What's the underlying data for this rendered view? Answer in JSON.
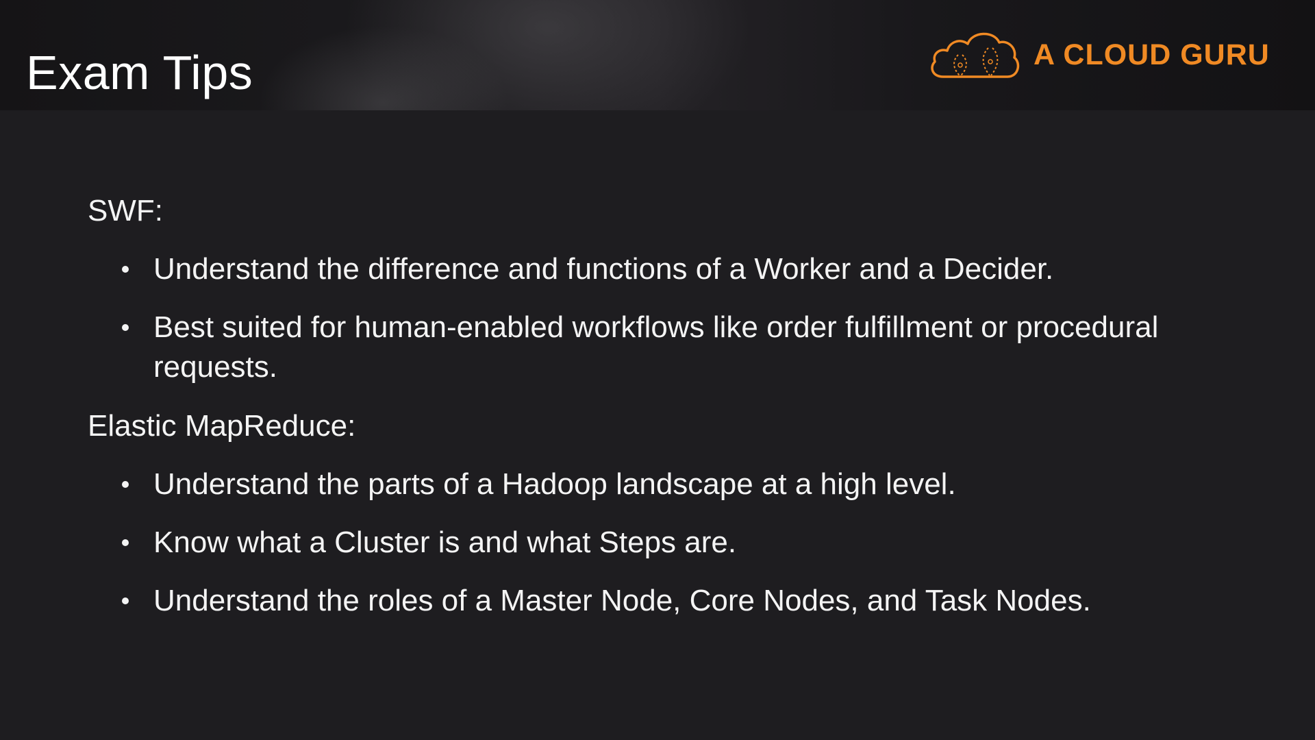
{
  "header": {
    "title": "Exam Tips",
    "logo_text": "A CLOUD GURU",
    "logo_icon": "cloud-icon",
    "accent_color": "#f08a24"
  },
  "sections": [
    {
      "heading": "SWF:",
      "bullets": [
        "Understand the difference and functions of a Worker and a Decider.",
        "Best suited for human-enabled workflows like order fulfillment or procedural requests."
      ]
    },
    {
      "heading": "Elastic MapReduce:",
      "bullets": [
        "Understand the parts of a Hadoop landscape at a high level.",
        "Know what a Cluster is and what Steps are.",
        "Understand the roles of a Master Node, Core Nodes, and Task Nodes."
      ]
    }
  ]
}
